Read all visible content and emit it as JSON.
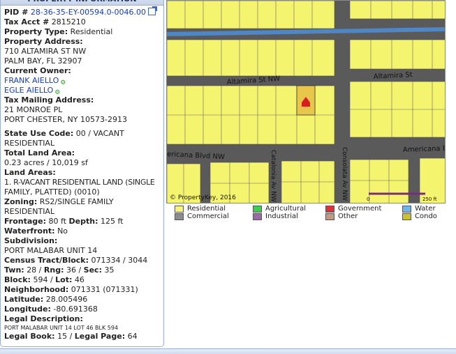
{
  "panel": {
    "header": "PROPERTY INFORMATION",
    "pid_label": "PID #",
    "pid_value": "28-36-35-EY-00594.0-0046.00",
    "tax_acct_label": "Tax Acct #",
    "tax_acct_value": "2815210",
    "property_type_label": "Property Type:",
    "property_type_value": "Residential",
    "property_address_label": "Property Address:",
    "property_address_line1": "710 ALTAMIRA ST NW",
    "property_address_line2": "PALM BAY, FL 32907",
    "current_owner_label": "Current Owner:",
    "owners": [
      "FRANK AIELLO",
      "EGLE AIELLO"
    ],
    "tax_mailing_label": "Tax Mailing Address:",
    "tax_mailing_line1": "21 MONROE PL",
    "tax_mailing_line2": "PORT CHESTER, NY 10573-2913",
    "state_use_code_label": "State Use Code:",
    "state_use_code_value": "00 / VACANT",
    "state_use_code_value2": "RESIDENTIAL",
    "total_land_area_label": "Total Land Area:",
    "total_land_area_value": "0.23 acres / 10,019 sf",
    "land_areas_label": "Land Areas:",
    "land_areas_line1": "1. R-VACANT RESIDENTIAL LAND (SINGLE",
    "land_areas_line2": "FAMILY, PLATTED) (0010)",
    "zoning_label": "Zoning:",
    "zoning_value": "RS2/SINGLE FAMILY",
    "zoning_value2": "RESIDENTIAL",
    "frontage_label": "Frontage:",
    "frontage_value": "80 ft",
    "depth_label": "Depth:",
    "depth_value": "125 ft",
    "waterfront_label": "Waterfront:",
    "waterfront_value": "No",
    "subdivision_label": "Subdivision:",
    "subdivision_value": "PORT MALABAR UNIT 14",
    "census_label": "Census Tract/Block:",
    "census_value": "071334 / 3044",
    "twn_label": "Twn:",
    "twn_value": "28",
    "rng_label": "Rng:",
    "rng_value": "36",
    "sec_label": "Sec:",
    "sec_value": "35",
    "block_label": "Block:",
    "block_value": "594",
    "lot_label": "Lot:",
    "lot_value": "46",
    "neighborhood_label": "Neighborhood:",
    "neighborhood_value": "071331 (071331)",
    "latitude_label": "Latitude:",
    "latitude_value": "28.005496",
    "longitude_label": "Longitude:",
    "longitude_value": "-80.691368",
    "legal_desc_label": "Legal Description:",
    "legal_desc_value": "PORT MALABAR UNIT 14 LOT 46 BLK 594",
    "legal_book_label": "Legal Book:",
    "legal_book_value": "15",
    "legal_page_label": "Legal Page:",
    "legal_page_value": "64"
  },
  "map": {
    "streets": {
      "altamira_left": "Altamira St NW",
      "altamira_right": "Altamira St",
      "americana_left": "ericana Blvd NW",
      "americana_right": "Americana B",
      "catalonia": "Catalonia Av NW",
      "consolata": "Consolata Av NW"
    },
    "copyright": "© PropertyKey, 2016",
    "scale_start": "0",
    "scale_end": "250 ft",
    "colors": {
      "parcel": "#f4f46e",
      "road": "#5a5a5a",
      "water": "#4f86c6",
      "marker": "#d81e1e"
    }
  },
  "legend": {
    "items": [
      {
        "label": "Residential",
        "color": "#f6f27a"
      },
      {
        "label": "Commercial",
        "color": "#8c8c8c"
      },
      {
        "label": "Agricultural",
        "color": "#3ccf4e"
      },
      {
        "label": "Industrial",
        "color": "#9a6aa8"
      },
      {
        "label": "Government",
        "color": "#e0303a"
      },
      {
        "label": "Other",
        "color": "#c29a84"
      },
      {
        "label": "Water",
        "color": "#6fb6ec"
      },
      {
        "label": "Condo",
        "color": "#c9c22a"
      }
    ]
  }
}
